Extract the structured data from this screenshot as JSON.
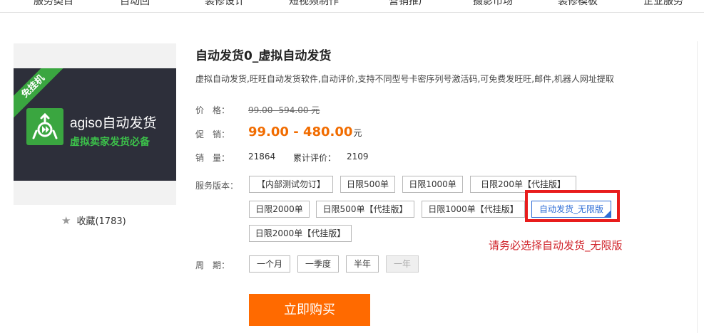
{
  "nav": {
    "items": [
      "服务类目",
      "自动回",
      "装修设计",
      "短视频制作",
      "营销推广",
      "摄影市场",
      "装修模板",
      "企业服务"
    ]
  },
  "product": {
    "ribbon": "免挂机",
    "brand_name": "agiso自动发货",
    "brand_tagline": "虚拟卖家发货必备",
    "favorite_label": "收藏(1783)",
    "title": "自动发货0_虚拟自动发货",
    "description": "虚拟自动发货,旺旺自动发货软件,自动评价,支持不同型号卡密序列号激活码,可免费发旺旺,邮件,机器人网址提取"
  },
  "pricing": {
    "price_label": "价　格：",
    "original_price": "99.00- 594.00 元",
    "promo_label": "促　销：",
    "promo_price": "99.00 - 480.00",
    "promo_unit": "元",
    "sales_label": "销　量：",
    "sales_value": "21864",
    "reviews_label": "累计评价：",
    "reviews_value": "2109"
  },
  "service": {
    "label": "服务版本：",
    "options": [
      "【内部测试勿订】",
      "日限500单",
      "日限1000单",
      "日限200单【代挂版】",
      "日限2000单",
      "日限500单【代挂版】",
      "日限1000单【代挂版】",
      "自动发货_无限版",
      "日限2000单【代挂版】"
    ],
    "selected": "自动发货_无限版"
  },
  "period": {
    "label": "周　期：",
    "options": [
      "一个月",
      "一季度",
      "半年",
      "一年"
    ],
    "disabled": "一年"
  },
  "hint": "请务必选择自动发货_无限版",
  "buy_label": "立即购买",
  "colors": {
    "accent": "#ff6a00",
    "price": "#f16c00",
    "selected": "#2d6cd6",
    "highlight": "#e81c1c",
    "brand_green": "#3aa640"
  }
}
